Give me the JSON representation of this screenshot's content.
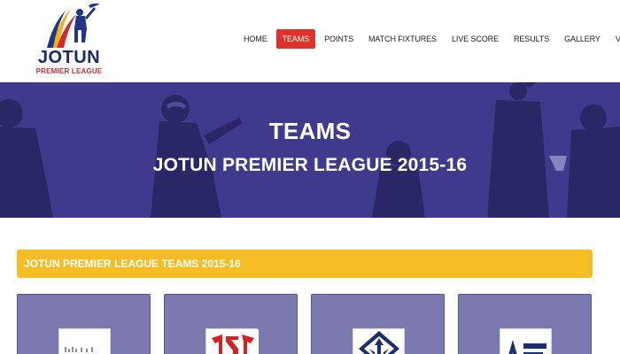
{
  "brand": {
    "title": "JOTUN",
    "subtitle": "PREMIER LEAGUE"
  },
  "nav": {
    "items": [
      {
        "label": "HOME",
        "active": false
      },
      {
        "label": "TEAMS",
        "active": true
      },
      {
        "label": "POINTS",
        "active": false
      },
      {
        "label": "MATCH FIXTURES",
        "active": false
      },
      {
        "label": "LIVE SCORE",
        "active": false
      },
      {
        "label": "RESULTS",
        "active": false
      },
      {
        "label": "GALLERY",
        "active": false
      },
      {
        "label": "VENUE",
        "active": false
      }
    ]
  },
  "banner": {
    "title": "TEAMS",
    "subtitle": "JOTUN PREMIER LEAGUE 2015-16"
  },
  "section": {
    "heading": "JOTUN PREMIER LEAGUE TEAMS 2015-16"
  },
  "colors": {
    "nav_active": "#e0312b",
    "banner_bg": "#3f3b8c",
    "section_bar": "#f6bc24",
    "card_bg": "#7b79b0",
    "brand_navy": "#1a2a6c"
  },
  "teams": [
    {
      "logo_icon": "team-logo-1-icon"
    },
    {
      "logo_icon": "team-logo-2-icon"
    },
    {
      "logo_icon": "team-logo-3-icon"
    },
    {
      "logo_icon": "team-logo-4-icon"
    }
  ]
}
